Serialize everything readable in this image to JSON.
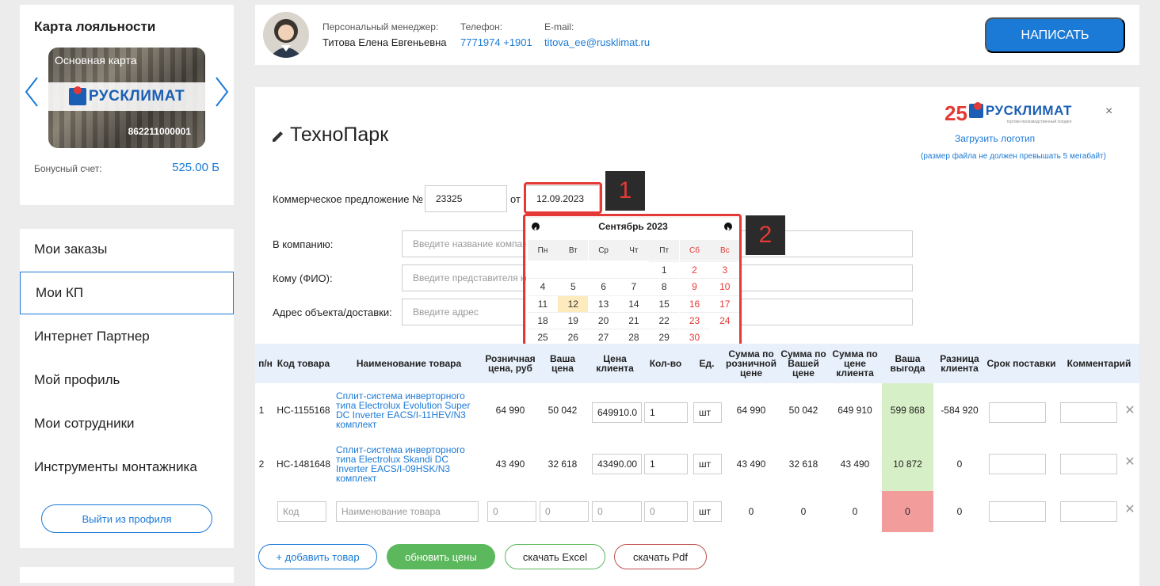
{
  "loyalty": {
    "title": "Карта лояльности",
    "card_label": "Основная карта",
    "card_brand": "РУСКЛИМАТ",
    "card_number": "862211000001",
    "bonus_label": "Бонусный счет:",
    "bonus_value": "525.00 Б"
  },
  "menu": {
    "items": [
      {
        "label": "Мои заказы"
      },
      {
        "label": "Мои КП"
      },
      {
        "label": "Интернет Партнер"
      },
      {
        "label": "Мой профиль"
      },
      {
        "label": "Мои сотрудники"
      },
      {
        "label": "Инструменты монтажника"
      }
    ],
    "active_index": 1,
    "logout": "Выйти из профиля"
  },
  "manager": {
    "label": "Персональный менеджер:",
    "name": "Титова Елена Евгеньевна",
    "phone_label": "Телефон:",
    "phone": "7771974 +1901",
    "email_label": "E-mail:",
    "email": "titova_ee@rusklimat.ru",
    "write_button": "НАПИСАТЬ"
  },
  "kp": {
    "title": "ТехноПарк",
    "logo_25": "25",
    "logo_brand": "РУСКЛИМАТ",
    "logo_tagline": "торгово-производственный холдинг",
    "upload_logo": "Загрузить логотип",
    "size_note": "(размер файла не должен превышать 5 мегабайт)",
    "close": "×",
    "offer_label": "Коммерческое предложение №",
    "offer_number": "23325",
    "from_label": "от",
    "date": "12.09.2023",
    "company_label": "В компанию:",
    "company_placeholder": "Введите название компании",
    "to_label": "Кому (ФИО):",
    "to_placeholder": "Введите представителя компании",
    "address_label": "Адрес объекта/доставки:",
    "address_placeholder": "Введите адрес"
  },
  "badges": {
    "one": "1",
    "two": "2"
  },
  "calendar": {
    "month": "Сентябрь 2023",
    "weekdays": [
      "Пн",
      "Вт",
      "Ср",
      "Чт",
      "Пт",
      "Сб",
      "Вс"
    ],
    "weeks": [
      [
        "",
        "",
        "",
        "",
        "1",
        "2",
        "3"
      ],
      [
        "4",
        "5",
        "6",
        "7",
        "8",
        "9",
        "10"
      ],
      [
        "11",
        "12",
        "13",
        "14",
        "15",
        "16",
        "17"
      ],
      [
        "18",
        "19",
        "20",
        "21",
        "22",
        "23",
        "24"
      ],
      [
        "25",
        "26",
        "27",
        "28",
        "29",
        "30",
        ""
      ]
    ],
    "selected": "12"
  },
  "table": {
    "headers": [
      "п/н",
      "Код товара",
      "Наименование товара",
      "Розничная цена, руб",
      "Ваша цена",
      "Цена клиента",
      "Кол-во",
      "Ед.",
      "Сумма по розничной цене",
      "Сумма по Вашей цене",
      "Сумма по цене клиента",
      "Ваша выгода",
      "Разница клиента",
      "Срок поставки",
      "Комментарий"
    ],
    "rows": [
      {
        "n": "1",
        "code": "НС-1155168",
        "name": "Сплит-система инверторного типа Electrolux Evolution Super DC Inverter EACS/I-11HEV/N3 комплект",
        "retail": "64 990",
        "your": "50 042",
        "client": "649910.0",
        "qty": "1",
        "unit": "шт",
        "sum_retail": "64 990",
        "sum_your": "50 042",
        "sum_client": "649 910",
        "gain": "599 868",
        "diff": "-584 920"
      },
      {
        "n": "2",
        "code": "НС-1481648",
        "name": "Сплит-система инверторного типа Electrolux Skandi DC Inverter EACS/I-09HSK/N3 комплект",
        "retail": "43 490",
        "your": "32 618",
        "client": "43490.00",
        "qty": "1",
        "unit": "шт",
        "sum_retail": "43 490",
        "sum_your": "32 618",
        "sum_client": "43 490",
        "gain": "10 872",
        "diff": "0"
      }
    ],
    "new_row": {
      "code_ph": "Код",
      "name_ph": "Наименование товара",
      "retail": "0",
      "your": "0",
      "client": "0",
      "qty": "0",
      "unit": "шт",
      "sum_retail": "0",
      "sum_your": "0",
      "sum_client": "0",
      "gain": "0",
      "diff": "0"
    },
    "colors": {
      "gain_pos": "#d7efc6",
      "gain_zero": "#f29c9c"
    }
  },
  "actions": {
    "add": "+ добавить товар",
    "update": "обновить цены",
    "excel": "скачать Excel",
    "pdf": "скачать Pdf"
  }
}
